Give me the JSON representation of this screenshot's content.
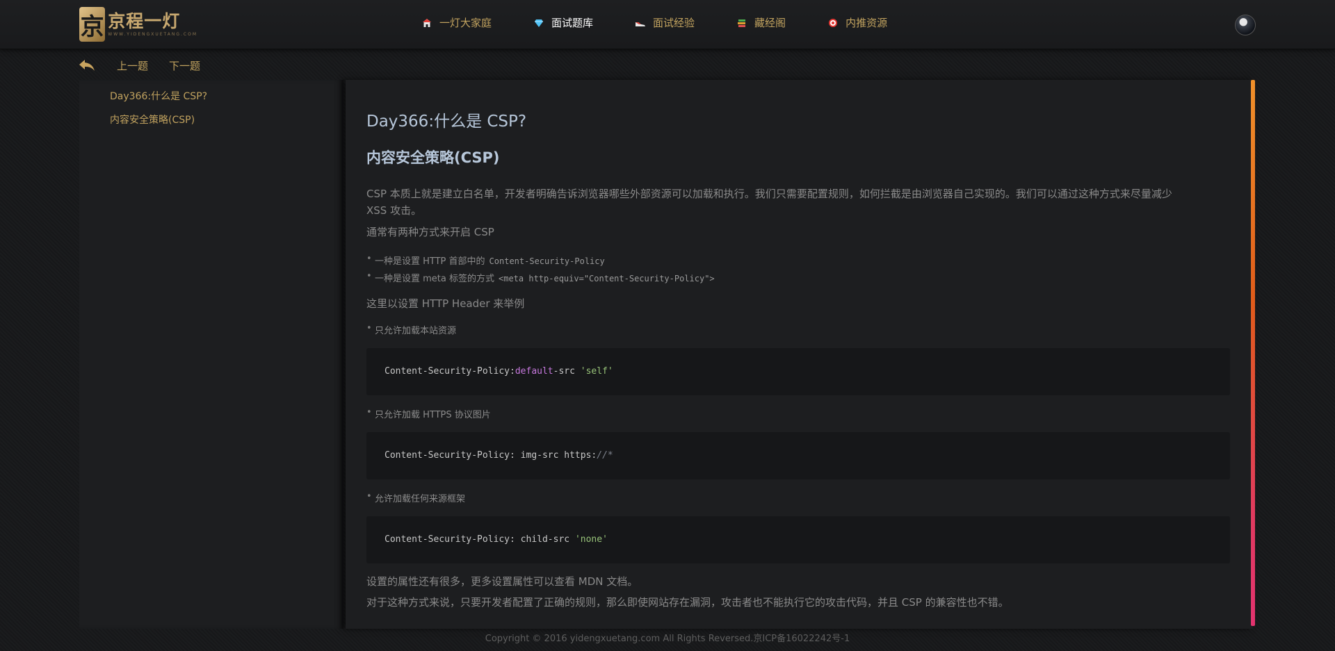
{
  "header": {
    "logo_cn": "京程一灯",
    "logo_en": "WWW.YIDENGXUETANG.COM",
    "nav": [
      {
        "label": "一灯大家庭",
        "icon": "house-icon"
      },
      {
        "label": "面试题库",
        "icon": "diamond-icon",
        "active": true
      },
      {
        "label": "面试经验",
        "icon": "shoe-icon"
      },
      {
        "label": "藏经阁",
        "icon": "books-icon"
      },
      {
        "label": "内推资源",
        "icon": "target-icon"
      }
    ]
  },
  "subnav": {
    "prev": "上一题",
    "next": "下一题"
  },
  "toc": {
    "items": [
      "Day366:什么是 CSP?",
      "内容安全策略(CSP)"
    ]
  },
  "article": {
    "title": "Day366:什么是 CSP?",
    "subtitle": "内容安全策略(CSP)",
    "p1_line1": "CSP 本质上就是建立白名单，开发者明确告诉浏览器哪些外部资源可以加载和执行。我们只需要配置规则，如何拦截是由浏览器自己实现的。我们可以通过这种方式来尽量减少",
    "p1_line2": "XSS 攻击。",
    "p2": "通常有两种方式来开启 CSP",
    "bullet1_text": "一种是设置 HTTP 首部中的",
    "bullet1_code": "Content-Security-Policy",
    "bullet2_text": "一种是设置 meta 标签的方式",
    "bullet2_code": "<meta http-equiv=\"Content-Security-Policy\">",
    "p3": "这里以设置 HTTP Header 来举例",
    "bullet3": "只允许加载本站资源",
    "code1_prefix": "Content-Security-Policy:",
    "code1_kw": "default",
    "code1_mid": "-src ",
    "code1_str": "'self'",
    "bullet4": "只允许加载 HTTPS 协议图片",
    "code2_prefix": "Content-Security-Policy: img-src https:",
    "code2_cmt": "//*",
    "bullet5": "允许加载任何来源框架",
    "code3_prefix": "Content-Security-Policy: child-src ",
    "code3_str": "'none'",
    "p4": "设置的属性还有很多，更多设置属性可以查看 MDN 文档。",
    "p5": "对于这种方式来说，只要开发者配置了正确的规则，那么即使网站存在漏洞，攻击者也不能执行它的攻击代码，并且 CSP 的兼容性也不错。"
  },
  "footer": {
    "text": "Copyright © 2016 yidengxuetang.com All Rights Reversed.京ICP备16022242号-1"
  }
}
